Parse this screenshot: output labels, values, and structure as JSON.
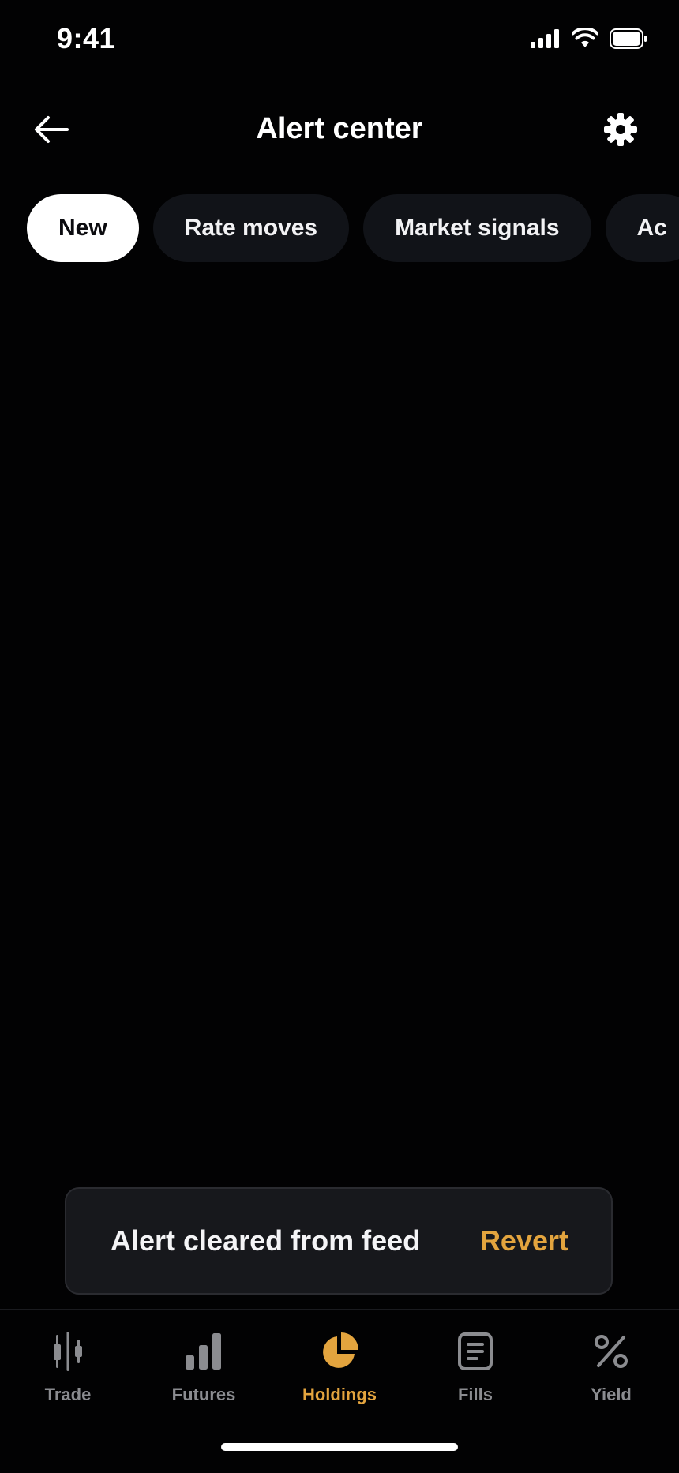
{
  "status_bar": {
    "time": "9:41"
  },
  "header": {
    "title": "Alert center"
  },
  "tabs": [
    {
      "label": "New",
      "active": true
    },
    {
      "label": "Rate moves",
      "active": false
    },
    {
      "label": "Market signals",
      "active": false
    },
    {
      "label": "Ac",
      "active": false
    }
  ],
  "snackbar": {
    "message": "Alert cleared from feed",
    "action": "Revert"
  },
  "bottom_nav": [
    {
      "label": "Trade",
      "icon": "candlestick-icon",
      "active": false
    },
    {
      "label": "Futures",
      "icon": "bar-chart-icon",
      "active": false
    },
    {
      "label": "Holdings",
      "icon": "pie-chart-icon",
      "active": true
    },
    {
      "label": "Fills",
      "icon": "document-icon",
      "active": false
    },
    {
      "label": "Yield",
      "icon": "percent-icon",
      "active": false
    }
  ],
  "colors": {
    "background": "#020203",
    "accent": "#e3a43e",
    "tab_bg": "#111318",
    "inactive_text": "#8b8c90"
  }
}
